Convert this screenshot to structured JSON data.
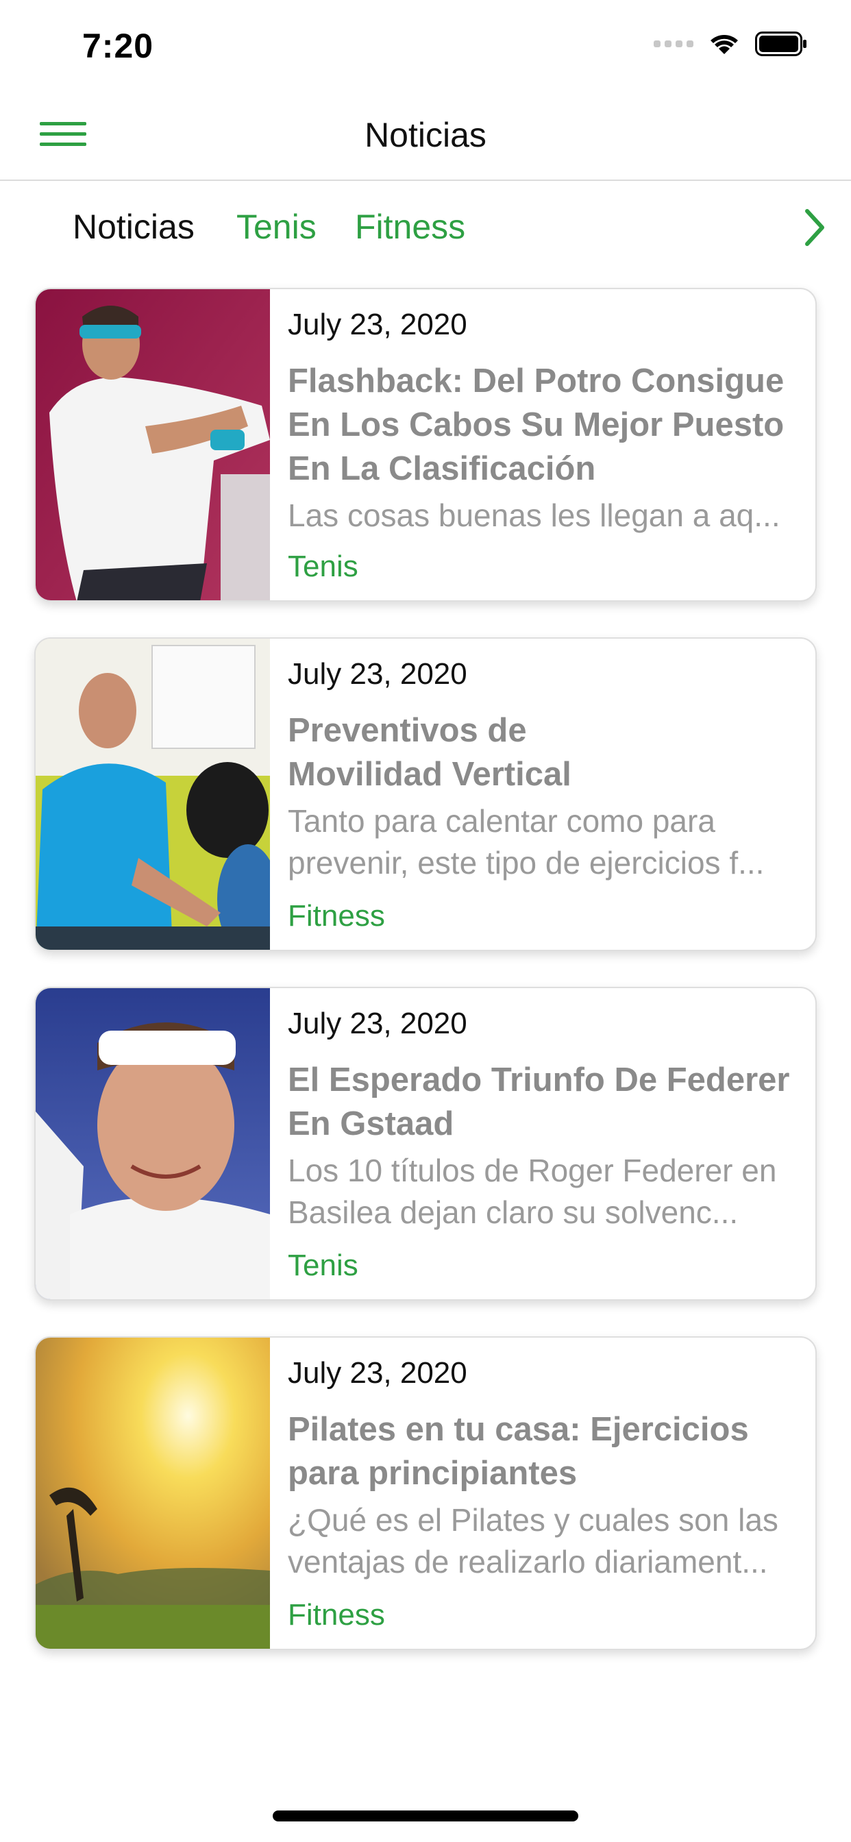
{
  "status_bar": {
    "time": "7:20"
  },
  "header": {
    "title": "Noticias"
  },
  "tabs": [
    {
      "label": "Noticias",
      "active": true
    },
    {
      "label": "Tenis",
      "active": false
    },
    {
      "label": "Fitness",
      "active": false
    }
  ],
  "colors": {
    "accent": "#2ea043",
    "title_gray": "#8a8a8a",
    "excerpt_gray": "#9a9a9a"
  },
  "articles": [
    {
      "date": "July 23, 2020",
      "title": "Flashback: Del Potro Consigue En Los Cabos Su Mejor Puesto En La Clasificación",
      "excerpt": "Las cosas buenas les llegan a aq...",
      "category": "Tenis",
      "image": "tennis-player-backhand-photo"
    },
    {
      "date": "July 23, 2020",
      "title": "Preventivos de Movilidad Vertical",
      "excerpt": "Tanto para calentar como para prevenir, este tipo de ejercicios f...",
      "category": "Fitness",
      "image": "fitness-trainer-photo"
    },
    {
      "date": "July 23, 2020",
      "title": "El Esperado Triunfo De Federer En Gstaad",
      "excerpt": "Los 10 títulos de Roger Federer en Basilea dejan claro su solvenc...",
      "category": "Tenis",
      "image": "federer-celebrating-photo"
    },
    {
      "date": "July 23, 2020",
      "title": "Pilates en tu casa: Ejercicios para principiantes",
      "excerpt": "¿Qué es el Pilates y cuales son las ventajas de realizarlo diariament...",
      "category": "Fitness",
      "image": "pilates-sunset-photo"
    }
  ]
}
